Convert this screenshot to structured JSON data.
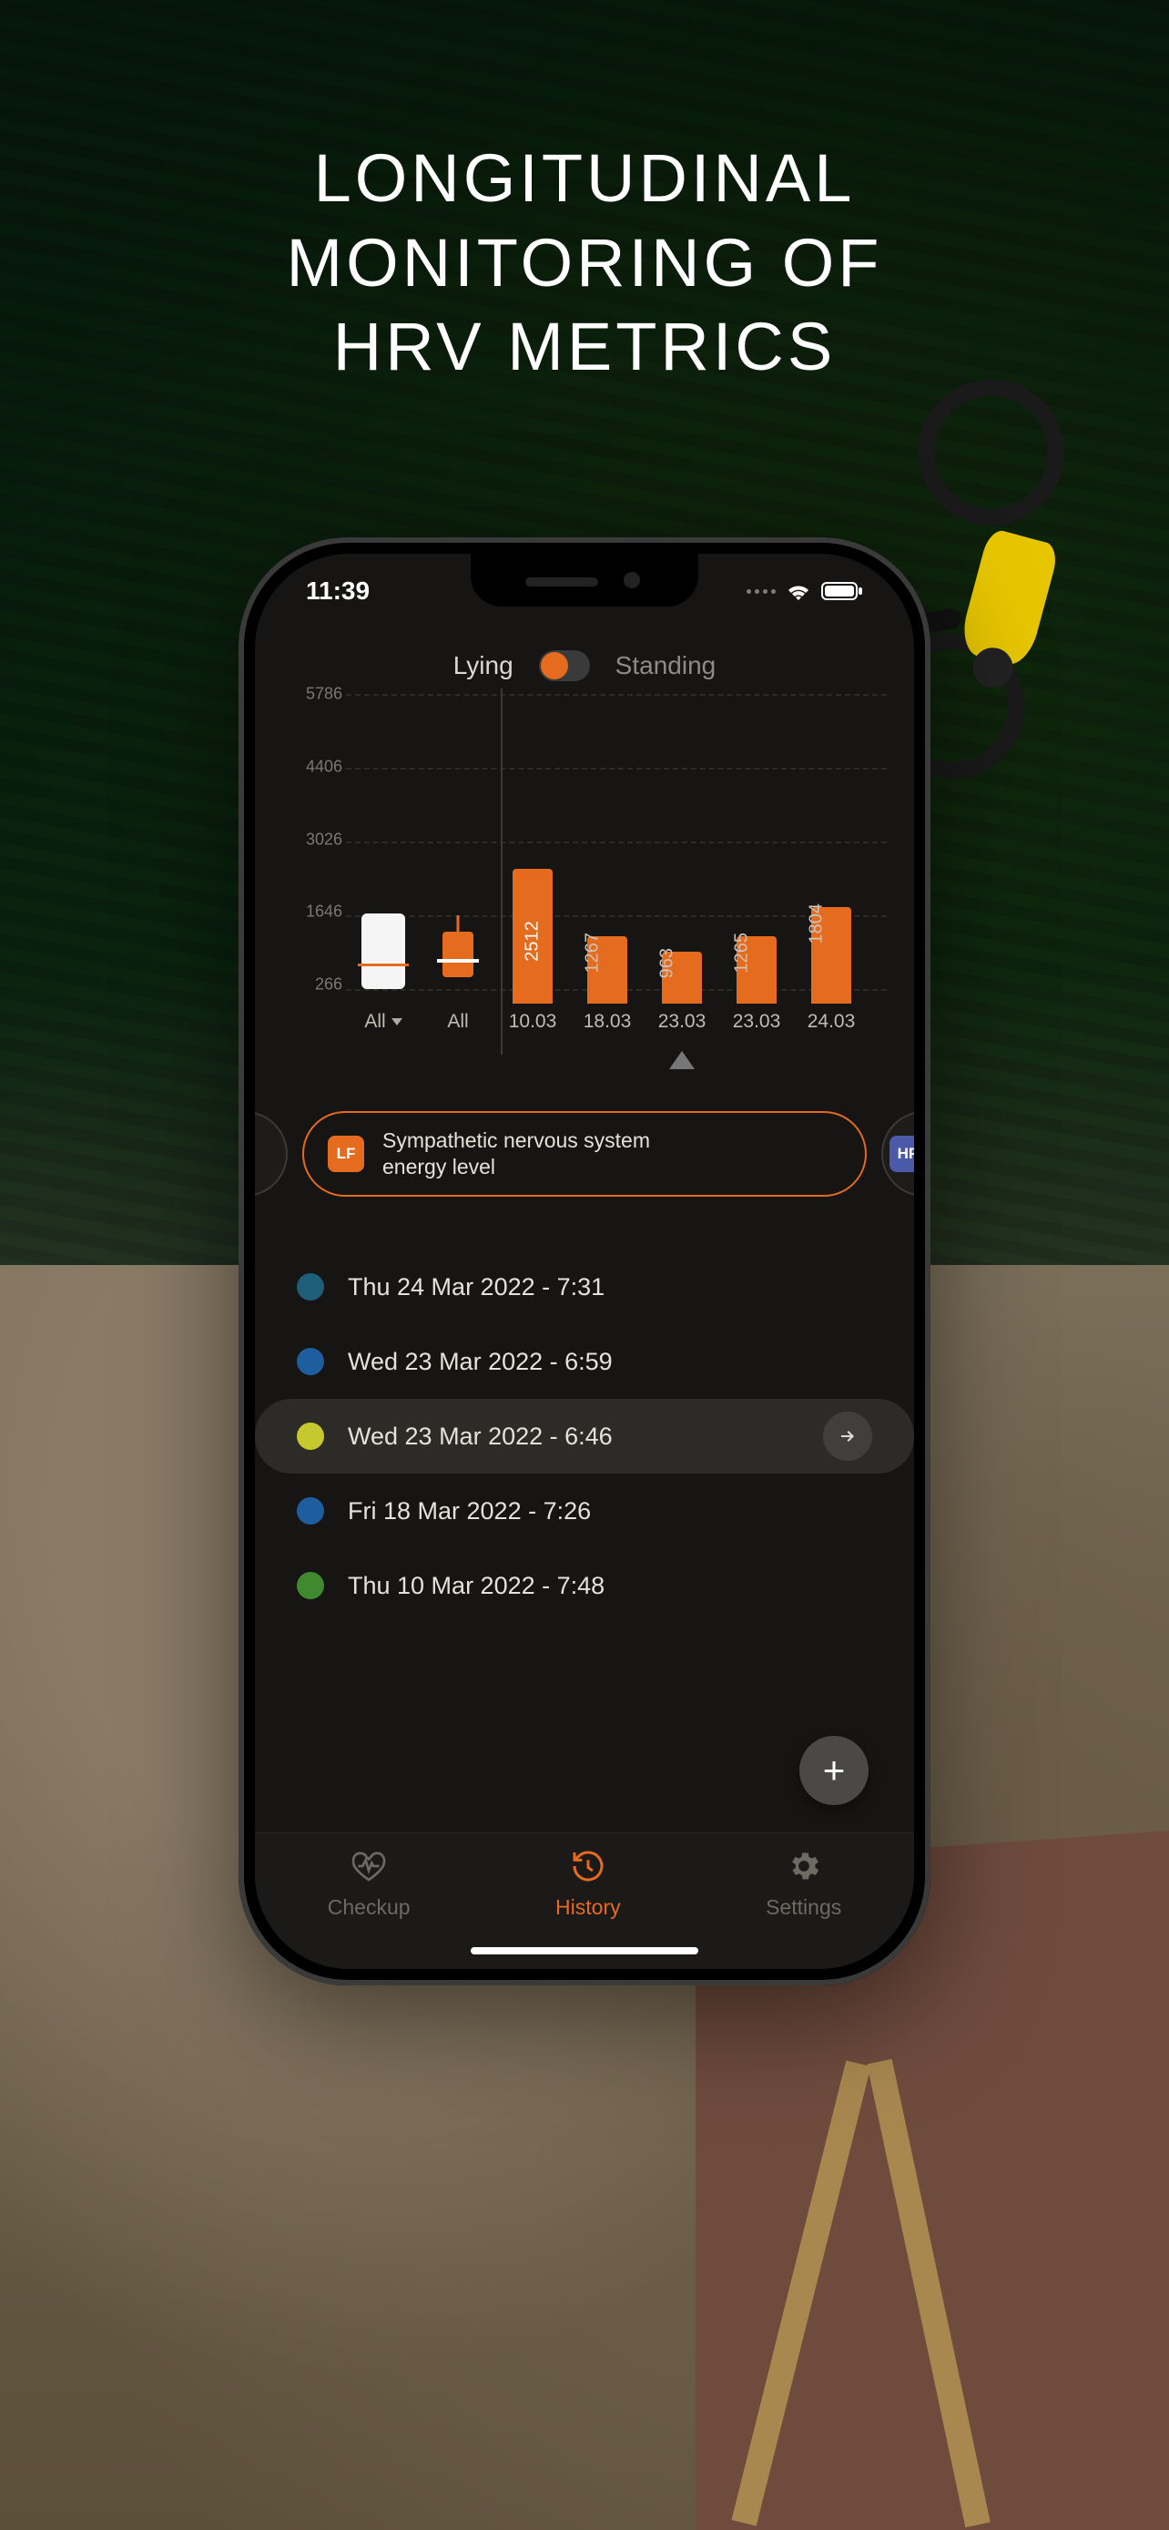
{
  "promo": {
    "line1": "LONGITUDINAL",
    "line2": "MONITORING OF",
    "line3": "HRV METRICS"
  },
  "status": {
    "time": "11:39"
  },
  "posture": {
    "lying": "Lying",
    "standing": "Standing",
    "active": "lying"
  },
  "chart_data": {
    "type": "bar",
    "ylim": [
      0,
      5786
    ],
    "yticks": [
      5786,
      4406,
      3026,
      1646,
      266
    ],
    "title": "",
    "xlabel": "",
    "ylabel": "",
    "summary": [
      {
        "label": "All",
        "has_dropdown": true,
        "box_low": 266,
        "box_high": 1680,
        "median": 700,
        "kind": "white"
      },
      {
        "label": "All",
        "has_dropdown": false,
        "box_low": 500,
        "box_high": 1350,
        "median": 760,
        "whisker_high": 1650,
        "kind": "orange"
      }
    ],
    "series": [
      {
        "date": "10.03",
        "value": 2512,
        "selected": false
      },
      {
        "date": "18.03",
        "value": 1267,
        "selected": false
      },
      {
        "date": "23.03",
        "value": 963,
        "selected": true
      },
      {
        "date": "23.03",
        "value": 1265,
        "selected": false
      },
      {
        "date": "24.03",
        "value": 1804,
        "selected": false
      }
    ]
  },
  "metric": {
    "lf_badge": "LF",
    "hf_badge": "HF",
    "title_line1": "Sympathetic nervous system",
    "title_line2": "energy level"
  },
  "history": [
    {
      "label": "Thu 24 Mar 2022 - 7:31",
      "color": "#1e5e78",
      "selected": false
    },
    {
      "label": "Wed 23 Mar 2022 - 6:59",
      "color": "#1e5e9e",
      "selected": false
    },
    {
      "label": "Wed 23 Mar 2022 - 6:46",
      "color": "#c6c82d",
      "selected": true
    },
    {
      "label": "Fri 18 Mar 2022 - 7:26",
      "color": "#1e5e9e",
      "selected": false
    },
    {
      "label": "Thu 10 Mar 2022 - 7:48",
      "color": "#3f8a2f",
      "selected": false
    }
  ],
  "fab": "+",
  "tabs": {
    "checkup": "Checkup",
    "history": "History",
    "settings": "Settings",
    "active": "history"
  }
}
